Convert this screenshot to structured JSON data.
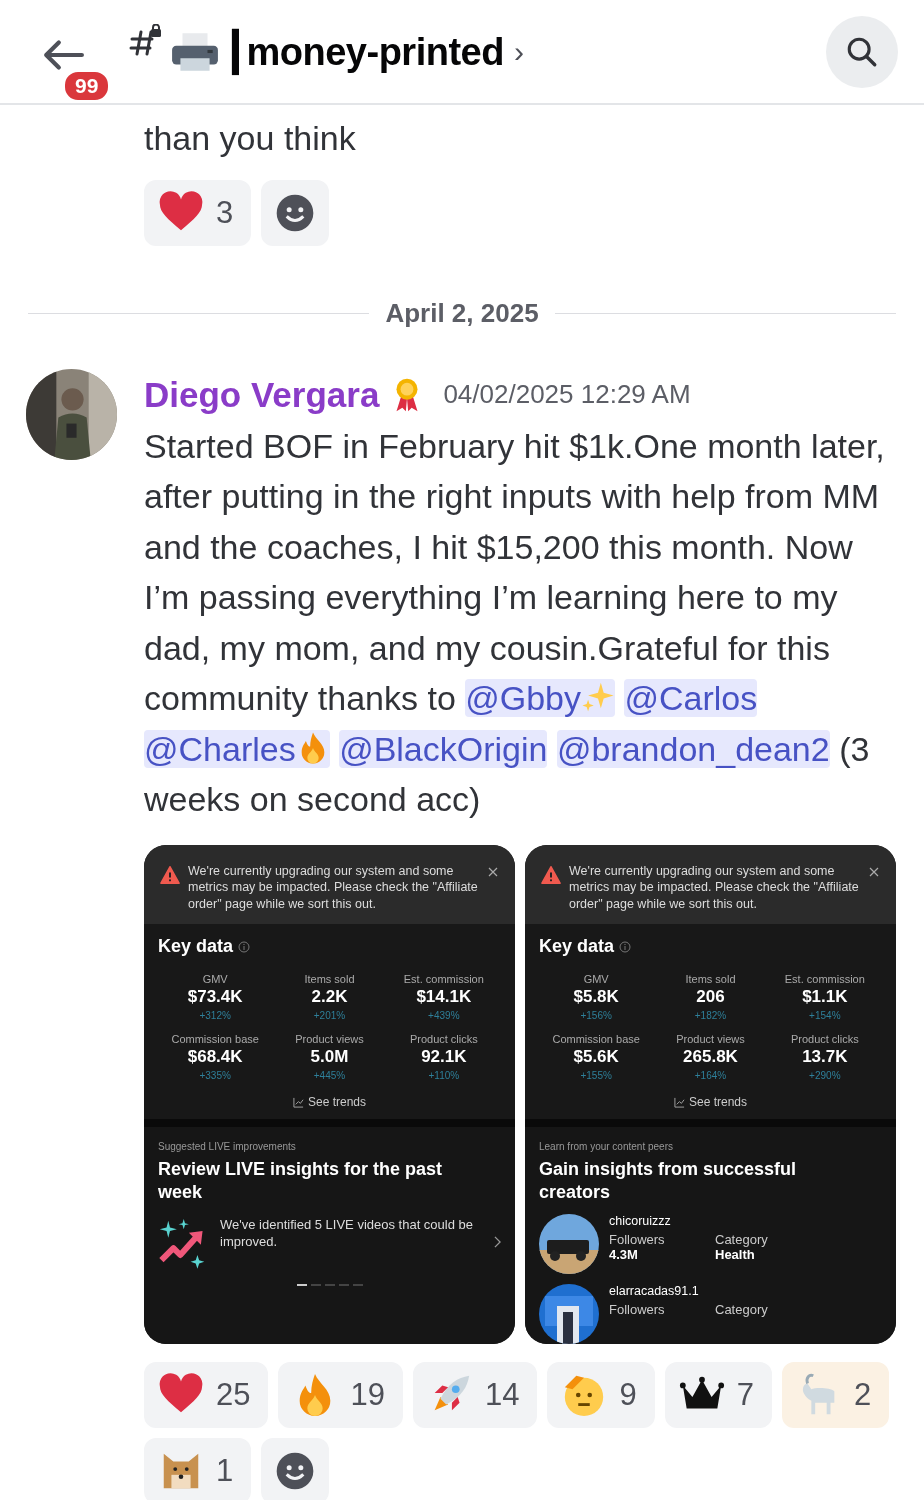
{
  "header": {
    "unread_badge": "99",
    "channel_name": "┃money-printed",
    "chevron": "›"
  },
  "previous_message": {
    "text": "than you think",
    "reactions": [
      {
        "kind": "heart",
        "count": "3",
        "selected": false
      }
    ]
  },
  "date_divider": "April 2, 2025",
  "message": {
    "author": "Diego Vergara",
    "timestamp": "04/02/2025 12:29 AM",
    "segments": [
      {
        "kind": "text",
        "text": "Started BOF in February hit $1k.One month later, after putting in the right inputs with help from MM and the coaches, I hit $15,200 this month. Now I’m passing everything I’m learning here to my dad, my mom, and my cousin.Grateful for this community thanks to "
      },
      {
        "kind": "mention",
        "text": "@Gbby"
      },
      {
        "kind": "mention",
        "text": "@Carlos"
      },
      {
        "kind": "mention",
        "text": "@Charles"
      },
      {
        "kind": "mention",
        "text": "@BlackOrigin"
      },
      {
        "kind": "mention",
        "text": "@brandon_dean2"
      },
      {
        "kind": "text",
        "text": " (3 weeks on second acc)"
      }
    ],
    "attachments": [
      {
        "banner": "We're currently upgrading our system and some metrics may be impacted. Please check the \"Affiliate order\" page while we sort this out.",
        "title": "Key data",
        "metrics": [
          {
            "label": "GMV",
            "value": "$73.4K",
            "change": "+312%"
          },
          {
            "label": "Items sold",
            "value": "2.2K",
            "change": "+201%"
          },
          {
            "label": "Est. commission",
            "value": "$14.1K",
            "change": "+439%"
          },
          {
            "label": "Commission base",
            "value": "$68.4K",
            "change": "+335%"
          },
          {
            "label": "Product views",
            "value": "5.0M",
            "change": "+445%"
          },
          {
            "label": "Product clicks",
            "value": "92.1K",
            "change": "+110%"
          }
        ],
        "trends": "See trends",
        "section": {
          "kind": "suggestion",
          "eyebrow": "Suggested LIVE improvements",
          "title": "Review LIVE insights for the past week",
          "text": "We've identified 5 LIVE videos that could be improved.",
          "pages": [
            {
              "selected": true
            },
            {
              "selected": false
            },
            {
              "selected": false
            },
            {
              "selected": false
            },
            {
              "selected": false
            }
          ]
        }
      },
      {
        "banner": "We're currently upgrading our system and some metrics may be impacted. Please check the \"Affiliate order\" page while we sort this out.",
        "title": "Key data",
        "metrics": [
          {
            "label": "GMV",
            "value": "$5.8K",
            "change": "+156%"
          },
          {
            "label": "Items sold",
            "value": "206",
            "change": "+182%"
          },
          {
            "label": "Est. commission",
            "value": "$1.1K",
            "change": "+154%"
          },
          {
            "label": "Commission base",
            "value": "$5.6K",
            "change": "+155%"
          },
          {
            "label": "Product views",
            "value": "265.8K",
            "change": "+164%"
          },
          {
            "label": "Product clicks",
            "value": "13.7K",
            "change": "+290%"
          }
        ],
        "trends": "See trends",
        "section": {
          "kind": "peers",
          "eyebrow": "Learn from your content peers",
          "title": "Gain insights from successful creators",
          "creators": [
            {
              "name": "chicoruizzz",
              "followers_label": "Followers",
              "followers": "4.3M",
              "category_label": "Category",
              "category": "Health"
            },
            {
              "name": "elarracadas91.1",
              "followers_label": "Followers",
              "category_label": "Category"
            }
          ]
        }
      }
    ],
    "reactions": [
      {
        "kind": "heart",
        "count": "25",
        "selected": false
      },
      {
        "kind": "fire",
        "count": "19",
        "selected": false
      },
      {
        "kind": "rocket",
        "count": "14",
        "selected": false
      },
      {
        "kind": "salute",
        "count": "9",
        "selected": false
      },
      {
        "kind": "crown",
        "count": "7",
        "selected": false
      },
      {
        "kind": "goat",
        "count": "2",
        "selected": true
      },
      {
        "kind": "dog",
        "count": "1",
        "selected": false
      }
    ]
  }
}
